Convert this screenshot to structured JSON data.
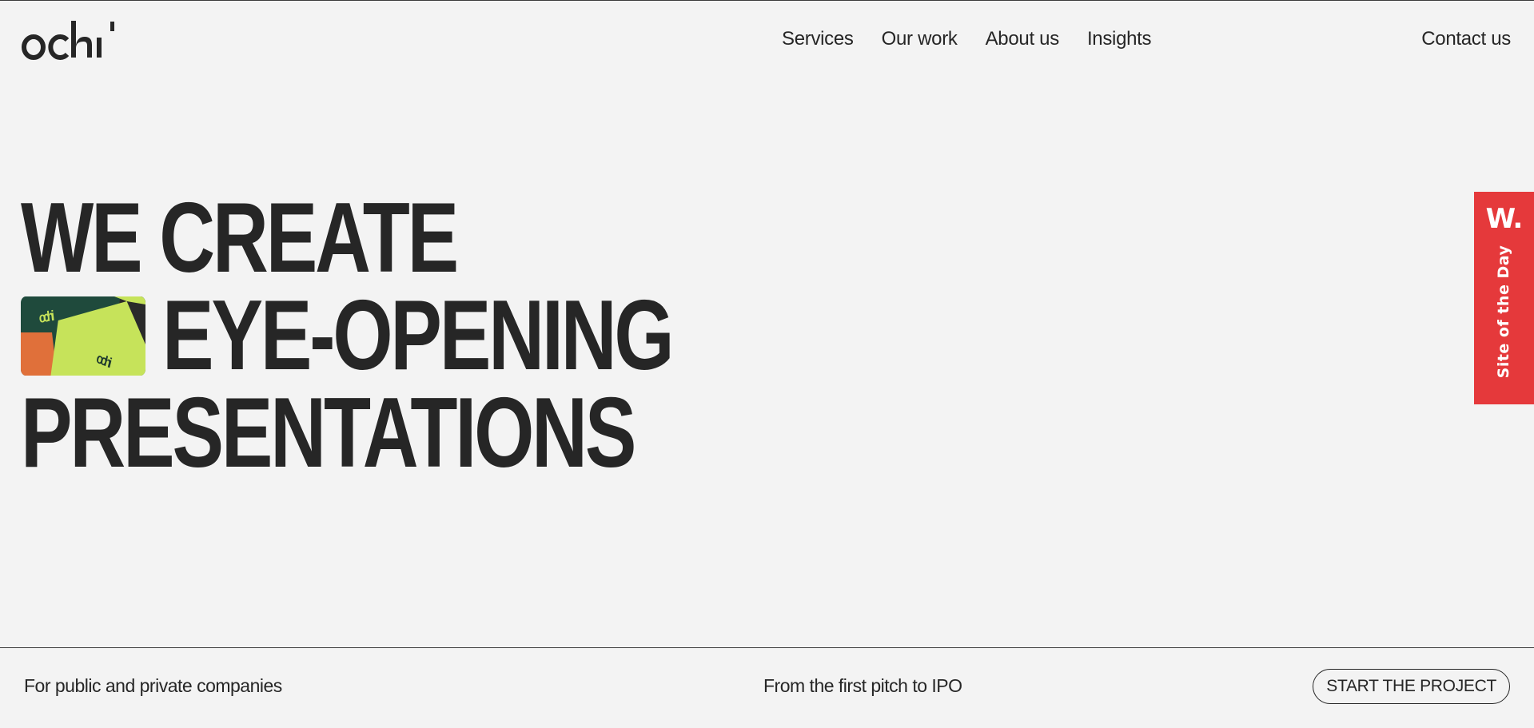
{
  "header": {
    "logo_text": "ochi",
    "nav": [
      {
        "label": "Services"
      },
      {
        "label": "Our work"
      },
      {
        "label": "About us"
      },
      {
        "label": "Insights"
      }
    ],
    "contact_label": "Contact us"
  },
  "hero": {
    "lines": [
      "WE CREATE",
      "EYE-OPENING",
      "PRESENTATIONS"
    ],
    "thumbnail": {
      "brand_text": "ochi",
      "colors": {
        "dark_green": "#1f4a3c",
        "lime": "#c6e35a",
        "orange": "#e0703a",
        "dark": "#2a2a2a"
      }
    }
  },
  "badge": {
    "mark": "W.",
    "label": "Site of the Day",
    "color": "#e5393b"
  },
  "footer": {
    "left_text": "For public and private companies",
    "middle_text": "From the first pitch to IPO",
    "cta_label": "START THE PROJECT"
  },
  "colors": {
    "background": "#f3f3f3",
    "text": "#262626"
  }
}
